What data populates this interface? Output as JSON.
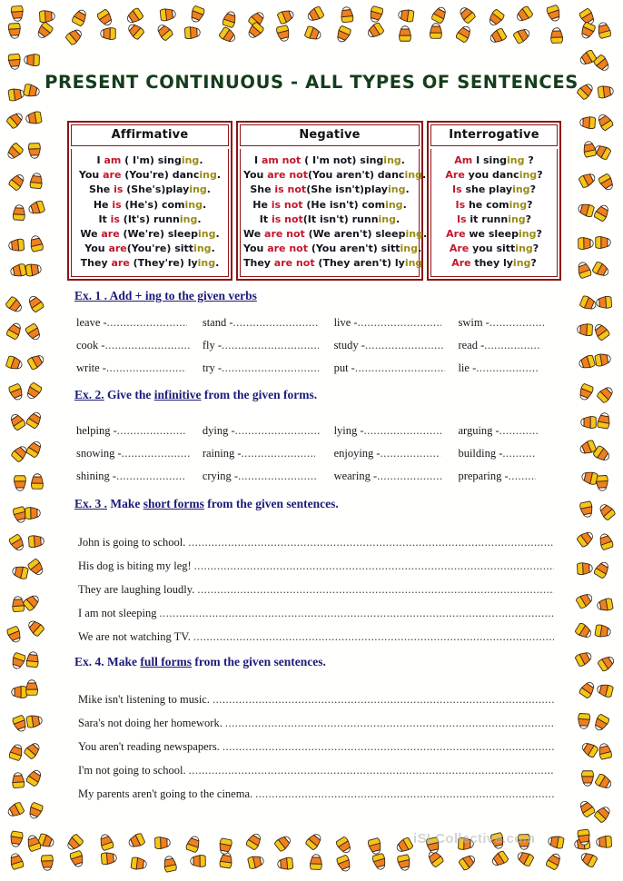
{
  "title": "PRESENT CONTINUOUS - ALL TYPES OF SENTENCES",
  "colors": {
    "title": "#143d1b",
    "table_border": "#8d1515",
    "auxiliary": "#c2172b",
    "ing_ending": "#9a8b15",
    "heading": "#1b1b7a",
    "candy_orange": "#ef7f1f",
    "candy_yellow": "#f5c518",
    "candy_white": "#ffffff"
  },
  "table": {
    "columns": [
      {
        "header": "Affirmative",
        "rows": [
          [
            {
              "t": "I ",
              "c": "p"
            },
            {
              "t": "am",
              "c": "a"
            },
            {
              "t": " ( I'm) sing",
              "c": "p"
            },
            {
              "t": "ing",
              "c": "g"
            },
            {
              "t": ".",
              "c": "p"
            }
          ],
          [
            {
              "t": "You ",
              "c": "p"
            },
            {
              "t": "are",
              "c": "a"
            },
            {
              "t": " (You're) danc",
              "c": "p"
            },
            {
              "t": "ing",
              "c": "g"
            },
            {
              "t": ".",
              "c": "p"
            }
          ],
          [
            {
              "t": "She ",
              "c": "p"
            },
            {
              "t": "is",
              "c": "a"
            },
            {
              "t": " (She's)play",
              "c": "p"
            },
            {
              "t": "ing",
              "c": "g"
            },
            {
              "t": ".",
              "c": "p"
            }
          ],
          [
            {
              "t": "He ",
              "c": "p"
            },
            {
              "t": "is",
              "c": "a"
            },
            {
              "t": " (He's) com",
              "c": "p"
            },
            {
              "t": "ing",
              "c": "g"
            },
            {
              "t": ".",
              "c": "p"
            }
          ],
          [
            {
              "t": "It ",
              "c": "p"
            },
            {
              "t": "is",
              "c": "a"
            },
            {
              "t": " (It's) runn",
              "c": "p"
            },
            {
              "t": "ing",
              "c": "g"
            },
            {
              "t": ".",
              "c": "p"
            }
          ],
          [
            {
              "t": "We ",
              "c": "p"
            },
            {
              "t": "are",
              "c": "a"
            },
            {
              "t": " (We're) sleep",
              "c": "p"
            },
            {
              "t": "ing",
              "c": "g"
            },
            {
              "t": ".",
              "c": "p"
            }
          ],
          [
            {
              "t": "You ",
              "c": "p"
            },
            {
              "t": "are",
              "c": "a"
            },
            {
              "t": "(You're) sitt",
              "c": "p"
            },
            {
              "t": "ing",
              "c": "g"
            },
            {
              "t": ".",
              "c": "p"
            }
          ],
          [
            {
              "t": "They ",
              "c": "p"
            },
            {
              "t": "are",
              "c": "a"
            },
            {
              "t": " (They're) ly",
              "c": "p"
            },
            {
              "t": "ing",
              "c": "g"
            },
            {
              "t": ".",
              "c": "p"
            }
          ]
        ]
      },
      {
        "header": "Negative",
        "rows": [
          [
            {
              "t": "I ",
              "c": "p"
            },
            {
              "t": "am not",
              "c": "a"
            },
            {
              "t": " ( I'm not) sing",
              "c": "p"
            },
            {
              "t": "ing",
              "c": "g"
            },
            {
              "t": ".",
              "c": "p"
            }
          ],
          [
            {
              "t": "You ",
              "c": "p"
            },
            {
              "t": "are not",
              "c": "a"
            },
            {
              "t": "(You aren't) danc",
              "c": "p"
            },
            {
              "t": "ing",
              "c": "g"
            },
            {
              "t": ".",
              "c": "p"
            }
          ],
          [
            {
              "t": "She ",
              "c": "p"
            },
            {
              "t": "is not",
              "c": "a"
            },
            {
              "t": "(She isn't)play",
              "c": "p"
            },
            {
              "t": "ing",
              "c": "g"
            },
            {
              "t": ".",
              "c": "p"
            }
          ],
          [
            {
              "t": "He ",
              "c": "p"
            },
            {
              "t": "is not",
              "c": "a"
            },
            {
              "t": " (He isn't) com",
              "c": "p"
            },
            {
              "t": "ing",
              "c": "g"
            },
            {
              "t": ".",
              "c": "p"
            }
          ],
          [
            {
              "t": "It ",
              "c": "p"
            },
            {
              "t": "is not",
              "c": "a"
            },
            {
              "t": "(It isn't) runn",
              "c": "p"
            },
            {
              "t": "ing",
              "c": "g"
            },
            {
              "t": ".",
              "c": "p"
            }
          ],
          [
            {
              "t": "We ",
              "c": "p"
            },
            {
              "t": "are not",
              "c": "a"
            },
            {
              "t": " (We aren't) sleep",
              "c": "p"
            },
            {
              "t": "ing",
              "c": "g"
            },
            {
              "t": ".",
              "c": "p"
            }
          ],
          [
            {
              "t": "You ",
              "c": "p"
            },
            {
              "t": "are not",
              "c": "a"
            },
            {
              "t": " (You aren't) sitt",
              "c": "p"
            },
            {
              "t": "ing",
              "c": "g"
            },
            {
              "t": ".",
              "c": "p"
            }
          ],
          [
            {
              "t": "They ",
              "c": "p"
            },
            {
              "t": "are not",
              "c": "a"
            },
            {
              "t": " (They aren't) ly",
              "c": "p"
            },
            {
              "t": "ing",
              "c": "g"
            }
          ]
        ]
      },
      {
        "header": "Interrogative",
        "rows": [
          [
            {
              "t": "Am",
              "c": "a"
            },
            {
              "t": " I sing",
              "c": "p"
            },
            {
              "t": "ing",
              "c": "g"
            },
            {
              "t": " ?",
              "c": "p"
            }
          ],
          [
            {
              "t": "Are",
              "c": "a"
            },
            {
              "t": " you danc",
              "c": "p"
            },
            {
              "t": "ing",
              "c": "g"
            },
            {
              "t": "?",
              "c": "p"
            }
          ],
          [
            {
              "t": "Is",
              "c": "a"
            },
            {
              "t": " she play",
              "c": "p"
            },
            {
              "t": "ing",
              "c": "g"
            },
            {
              "t": "?",
              "c": "p"
            }
          ],
          [
            {
              "t": "Is",
              "c": "a"
            },
            {
              "t": " he com",
              "c": "p"
            },
            {
              "t": "ing",
              "c": "g"
            },
            {
              "t": "?",
              "c": "p"
            }
          ],
          [
            {
              "t": "Is",
              "c": "a"
            },
            {
              "t": " it runn",
              "c": "p"
            },
            {
              "t": "ing",
              "c": "g"
            },
            {
              "t": "?",
              "c": "p"
            }
          ],
          [
            {
              "t": "Are",
              "c": "a"
            },
            {
              "t": " we sleep",
              "c": "p"
            },
            {
              "t": "ing",
              "c": "g"
            },
            {
              "t": "?",
              "c": "p"
            }
          ],
          [
            {
              "t": "Are",
              "c": "a"
            },
            {
              "t": " you sitt",
              "c": "p"
            },
            {
              "t": "ing",
              "c": "g"
            },
            {
              "t": "?",
              "c": "p"
            }
          ],
          [
            {
              "t": "Are",
              "c": "a"
            },
            {
              "t": " they ly",
              "c": "p"
            },
            {
              "t": "ing",
              "c": "g"
            },
            {
              "t": "?",
              "c": "p"
            }
          ]
        ]
      }
    ]
  },
  "exercises": [
    {
      "id": "ex1",
      "heading_parts": [
        {
          "t": "Ex. 1 . Add + ing to the given verbs",
          "u": true
        }
      ],
      "type": "grid",
      "rows": [
        [
          "leave",
          "stand",
          "live",
          "swim"
        ],
        [
          "cook",
          "fly",
          "study",
          "read"
        ],
        [
          "write",
          "try",
          "put",
          "lie"
        ]
      ]
    },
    {
      "id": "ex2",
      "heading_parts": [
        {
          "t": "Ex. 2.",
          "u": true
        },
        {
          "t": " Give the ",
          "u": false
        },
        {
          "t": "infinitive",
          "u": true
        },
        {
          "t": " from the given forms.",
          "u": false
        }
      ],
      "type": "grid",
      "rows": [
        [
          "helping",
          "dying",
          "lying",
          "arguing"
        ],
        [
          "snowing",
          "raining",
          "enjoying",
          "building"
        ],
        [
          "shining",
          "crying",
          "wearing",
          "preparing"
        ]
      ]
    },
    {
      "id": "ex3",
      "heading_parts": [
        {
          "t": "Ex. 3 .",
          "u": true
        },
        {
          "t": " Make ",
          "u": false
        },
        {
          "t": "short forms",
          "u": true
        },
        {
          "t": " from the given sentences.",
          "u": false
        }
      ],
      "type": "lines",
      "sentences": [
        "John is going to school.",
        "His dog is biting my leg!",
        "They are laughing loudly.",
        "I am not sleeping",
        "We are not watching TV."
      ]
    },
    {
      "id": "ex4",
      "heading_parts": [
        {
          "t": "Ex. 4. Make ",
          "u": false
        },
        {
          "t": "full forms",
          "u": true
        },
        {
          "t": " from the given sentences.",
          "u": false
        }
      ],
      "type": "lines",
      "sentences": [
        "Mike isn't listening to music.",
        "Sara's not doing her homework.",
        "You aren't reading  newspapers.",
        "I'm not going to school.",
        "My parents aren't going to the cinema."
      ]
    }
  ],
  "watermark": "iSLCollective.com"
}
